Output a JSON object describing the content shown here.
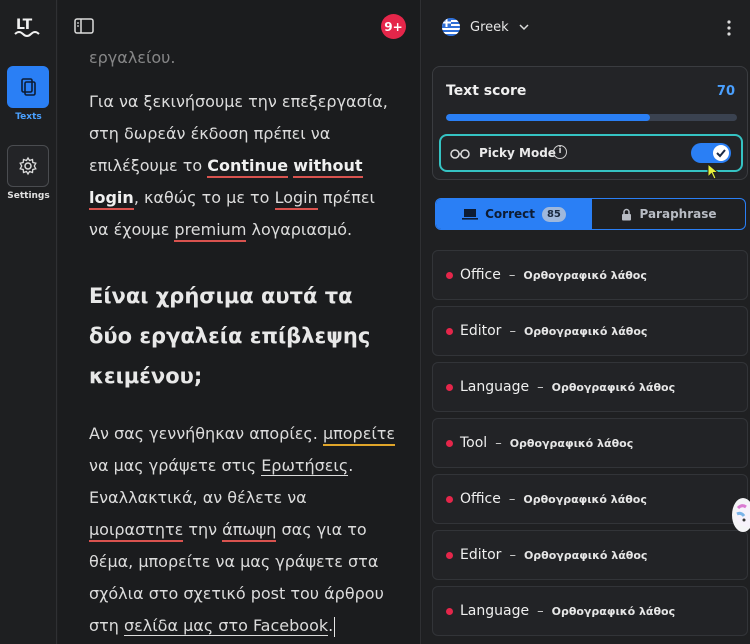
{
  "nav": {
    "items": [
      {
        "label": "Texts",
        "icon": "document-icon",
        "active": true
      },
      {
        "label": "Settings",
        "icon": "gear-icon",
        "active": false
      }
    ]
  },
  "editor": {
    "notification_count": "9+",
    "cut_text": "εργαλείου.",
    "p1_a": "Για να ξεκινήσουμε την επεξεργασία, στη δωρεάν έκδοση πρέπει να επιλέξουμε το ",
    "p1_continue": "Continue",
    "p1_without": "without",
    "p1_login": "login",
    "p1_b": ", καθώς το με το ",
    "p1_login2": "Login",
    "p1_c": " πρέπει να έχουμε ",
    "p1_premium": "premium",
    "p1_d": " λογαριασμό.",
    "heading": "Είναι χρήσιμα αυτά τα δύο εργαλεία επίβλεψης κειμένου;",
    "p2_a": "Αν σας γεννήθηκαν απορίες. ",
    "p2_mporeite": "μπορείτε",
    "p2_b": " να μας γράψετε στις ",
    "p2_erotiseis": "Ερωτήσεις",
    "p2_c": ". Εναλλακτικά, αν θέλετε να ",
    "p2_moirastite": "μοιραστητε",
    "p2_d": " την ",
    "p2_apopsi": "άπωψη",
    "p2_e": " σας για το θέμα, μπορείτε να μας γράψετε στα σχόλια στο σχετικό post του άρθρου στη ",
    "p2_selida": "σελίδα μας στο Facebook",
    "p2_f": "."
  },
  "panel": {
    "language": "Greek",
    "score_label": "Text score",
    "score_value": "70",
    "score_fraction": 0.7,
    "picky_label": "Picky Mode",
    "picky_on": true,
    "tab_correct": "Correct",
    "tab_correct_count": "85",
    "tab_paraphrase": "Paraphrase",
    "issues": [
      {
        "word": "Office",
        "type": "Ορθογραφικό λάθος"
      },
      {
        "word": "Editor",
        "type": "Ορθογραφικό λάθος"
      },
      {
        "word": "Language",
        "type": "Ορθογραφικό λάθος"
      },
      {
        "word": "Tool",
        "type": "Ορθογραφικό λάθος"
      },
      {
        "word": "Office",
        "type": "Ορθογραφικό λάθος"
      },
      {
        "word": "Editor",
        "type": "Ορθογραφικό λάθος"
      },
      {
        "word": "Language",
        "type": "Ορθογραφικό λάθος"
      }
    ],
    "dash": "–"
  },
  "colors": {
    "accent": "#2a7ff5",
    "error": "#e5264a",
    "highlight": "#35c3c3"
  }
}
